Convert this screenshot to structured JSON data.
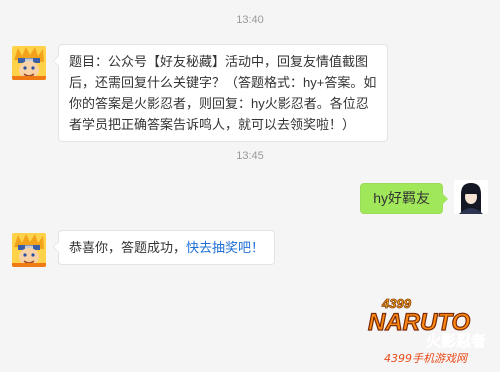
{
  "messages": [
    {
      "time": "13:40",
      "sender": "bot",
      "text": "题目：公众号【好友秘藏】活动中，回复友情值截图后，还需回复什么关键字？（答题格式：hy+答案。如你的答案是火影忍者，则回复：hy火影忍者。各位忍者学员把正确答案告诉鸣人，就可以去领奖啦！）"
    },
    {
      "time": "13:45",
      "sender": "user",
      "text": "hy好羁友"
    },
    {
      "sender": "bot",
      "text": "恭喜你，答题成功，",
      "link": "快去抽奖吧！"
    }
  ],
  "watermark": {
    "brand": "NARUTO",
    "number": "4399",
    "cn_title": "火影忍者",
    "subtitle": "4399手机游戏网"
  },
  "colors": {
    "background": "#f5f5f5",
    "bubble_in": "#ffffff",
    "bubble_out": "#a0e75a",
    "link": "#1d6fd6"
  }
}
